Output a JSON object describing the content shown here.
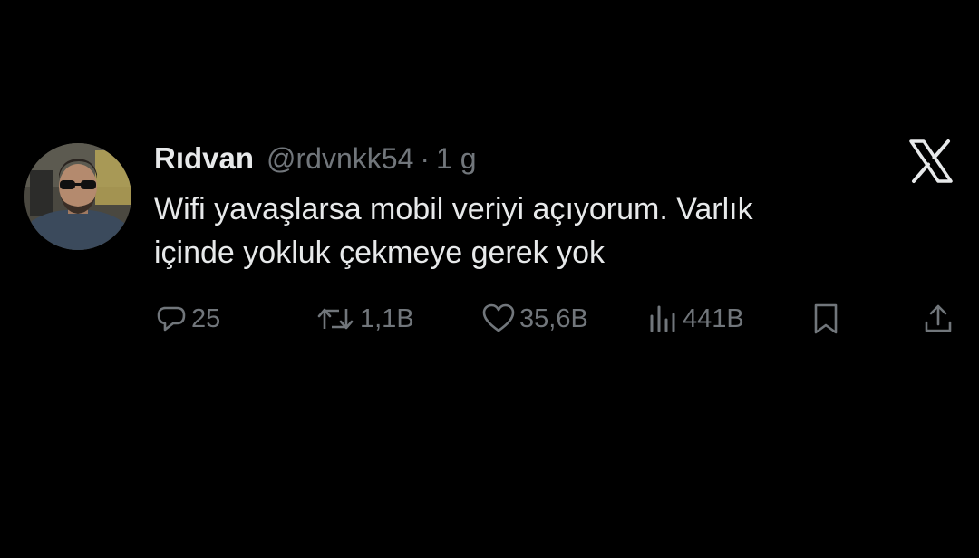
{
  "tweet": {
    "author": {
      "display_name": "Rıdvan",
      "handle": "@rdvnkk54"
    },
    "separator": "·",
    "time": "1 g",
    "text_lines": [
      "Wifi yavaşlarsa mobil veriyi açıyorum. Varlık",
      "içinde yokluk çekmeye gerek yok"
    ],
    "brand_icon": "x-logo-icon",
    "actions": {
      "reply": {
        "icon": "reply-icon",
        "count": "25"
      },
      "retweet": {
        "icon": "retweet-icon",
        "count": "1,1B"
      },
      "like": {
        "icon": "heart-icon",
        "count": "35,6B"
      },
      "views": {
        "icon": "views-icon",
        "count": "441B"
      },
      "bookmark": {
        "icon": "bookmark-icon"
      },
      "share": {
        "icon": "share-icon"
      }
    }
  },
  "colors": {
    "background": "#000000",
    "primary_text": "#e7e9ea",
    "secondary_text": "#71767b"
  }
}
